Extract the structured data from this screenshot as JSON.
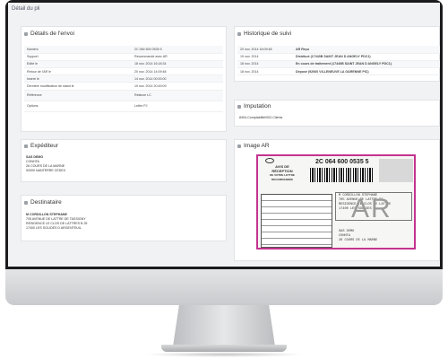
{
  "page": {
    "title": "Détail du pli"
  },
  "envoi": {
    "title": "Détails de l'envoi",
    "rows": [
      {
        "label": "Numéro",
        "value": "2C 064 600 0535 5"
      },
      {
        "label": "Support",
        "value": "Recommandé avec AR"
      },
      {
        "label": "Edité le",
        "value": "18 nov. 2014 16:18:34"
      },
      {
        "label": "Retour de l'AR le",
        "value": "20 nov. 2014 14:09:48"
      },
      {
        "label": "Inséré le",
        "value": "14 nov. 2014 00:00:00"
      },
      {
        "label": "Dernière modification de statut le",
        "value": "19 nov. 2014 20:49:09"
      },
      {
        "label": "Référence",
        "value": "Relance LC"
      },
      {
        "label": "Options",
        "value": "Lettre PJ"
      }
    ]
  },
  "historique": {
    "title": "Historique de suivi",
    "rows": [
      {
        "date": "20 nov. 2014 16:09:48",
        "event": "AR Reçu"
      },
      {
        "date": "19 nov. 2014",
        "event": "Distribué (17440B SAINT JEAN D ANGELY PDC1)"
      },
      {
        "date": "18 nov. 2014",
        "event": "En cours de traitement (17440B SAINT JEAN D ANGELY PDC1)"
      },
      {
        "date": "18 nov. 2014",
        "event": "Déposé (92060 VILLENEUVE LA GARENNE PIC)"
      }
    ]
  },
  "imputation": {
    "title": "Imputation",
    "value": "8404-Comptabilité/002-Clients"
  },
  "expediteur": {
    "title": "Expéditeur",
    "lines": [
      "SAS DEMO",
      "CONHTA",
      "26 COURS DE LA MARNE",
      "92000 NANTERRE CEDEX"
    ]
  },
  "destinataire": {
    "title": "Destinataire",
    "lines": [
      "M CORDILLON STEPHANE",
      "705 AVENUE DE LATTRE DE TASSIGNY",
      "RESIDENCE LE CLOS DE LATTRES B 25",
      "17400 LES SOLIDES D ARGENTEUIL"
    ]
  },
  "image_ar": {
    "title": "Image AR",
    "number": "2C 064 600 0535 5",
    "header": [
      "AVIS DE",
      "RÉCEPTION",
      "DE VOTRE LETTRE",
      "RECOMMANDÉE"
    ],
    "stamp": "AR",
    "dest_lines": [
      "M CORDILLON STEPHANE",
      "705 AVENUE DE LATTRE DE",
      "RESIDENCE LE CLOS DE LATTRE",
      "17400 LES SOLIDES"
    ],
    "sender_lines": [
      "SAS DEMO",
      "CONHTA",
      "26 COURS DE LA MARNE"
    ]
  },
  "colors": {
    "frame": "#1b1b1d",
    "accent": "#c4338f"
  }
}
